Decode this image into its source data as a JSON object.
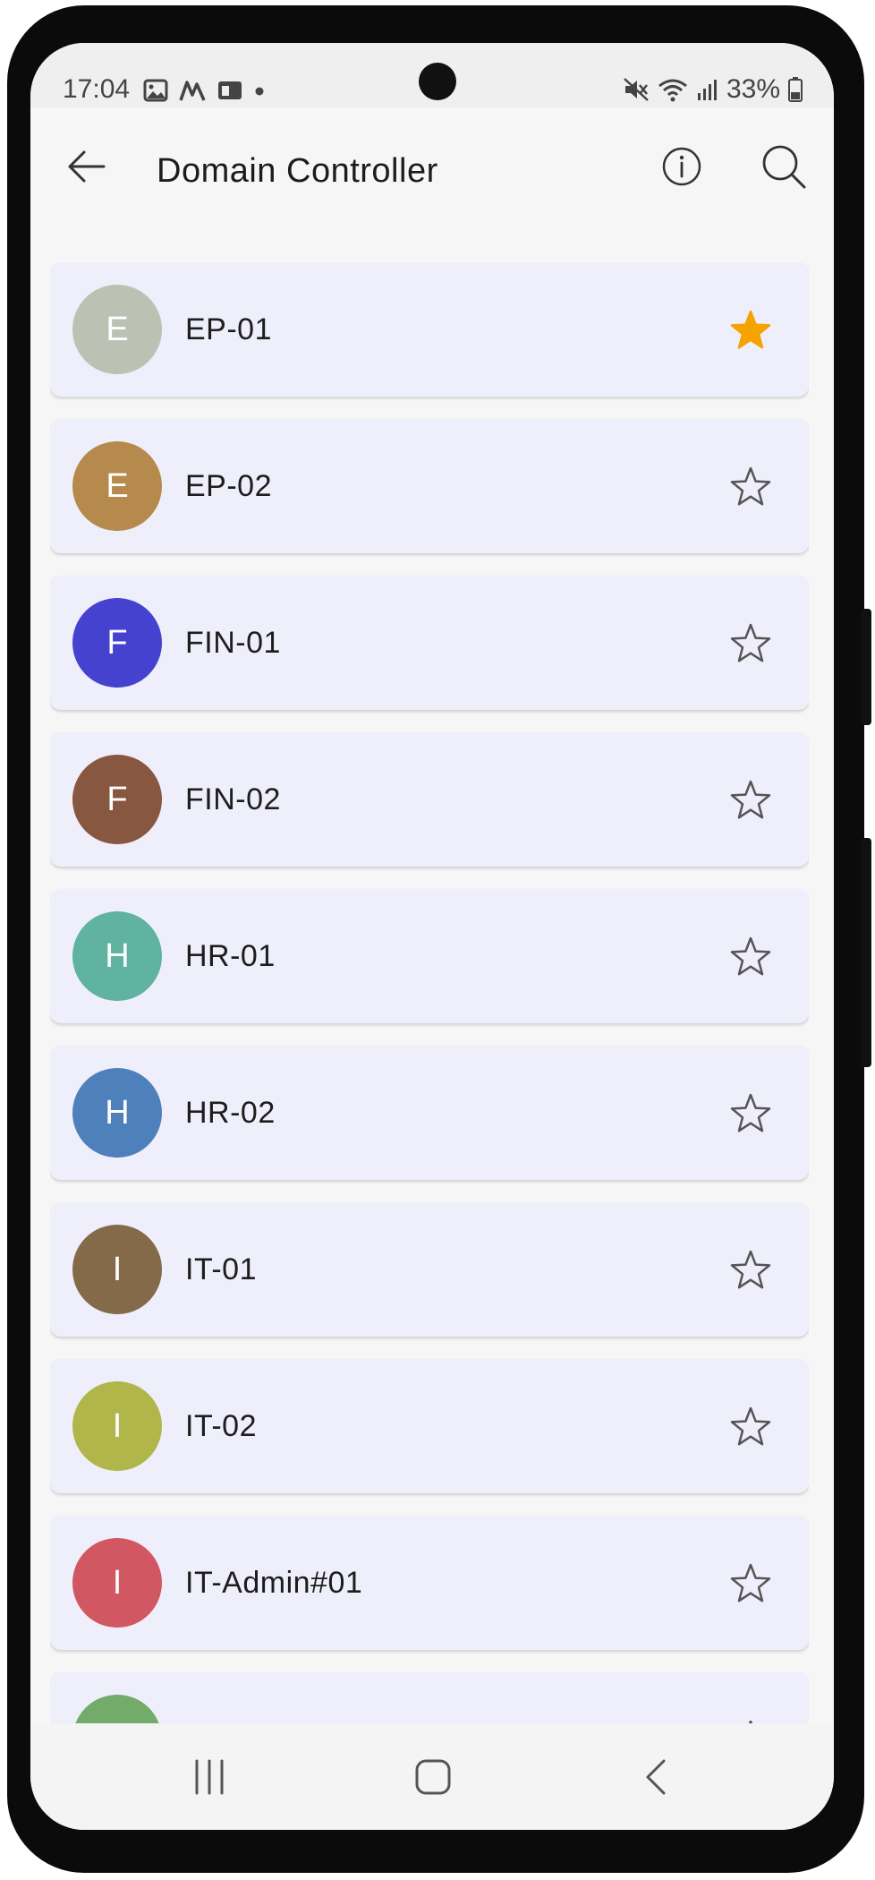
{
  "status_bar": {
    "time": "17:04",
    "battery": "33%"
  },
  "app_bar": {
    "title": "Domain Controller"
  },
  "colors": {
    "favorite_star": "#f5a300",
    "outline_star": "#555555",
    "card_background": "#efeffb"
  },
  "items": [
    {
      "initial": "E",
      "label": "EP-01",
      "avatar_color": "#bcc2b3",
      "favorite": true
    },
    {
      "initial": "E",
      "label": "EP-02",
      "avatar_color": "#b68a4d",
      "favorite": false
    },
    {
      "initial": "F",
      "label": "FIN-01",
      "avatar_color": "#4542cf",
      "favorite": false
    },
    {
      "initial": "F",
      "label": "FIN-02",
      "avatar_color": "#885740",
      "favorite": false
    },
    {
      "initial": "H",
      "label": "HR-01",
      "avatar_color": "#5fb3a0",
      "favorite": false
    },
    {
      "initial": "H",
      "label": "HR-02",
      "avatar_color": "#4e80bb",
      "favorite": false
    },
    {
      "initial": "I",
      "label": "IT-01",
      "avatar_color": "#856a4a",
      "favorite": false
    },
    {
      "initial": "I",
      "label": "IT-02",
      "avatar_color": "#b0b64a",
      "favorite": false
    },
    {
      "initial": "I",
      "label": "IT-Admin#01",
      "avatar_color": "#d15862",
      "favorite": false
    },
    {
      "initial": "",
      "label": "",
      "avatar_color": "#73ab6a",
      "favorite": false
    }
  ]
}
